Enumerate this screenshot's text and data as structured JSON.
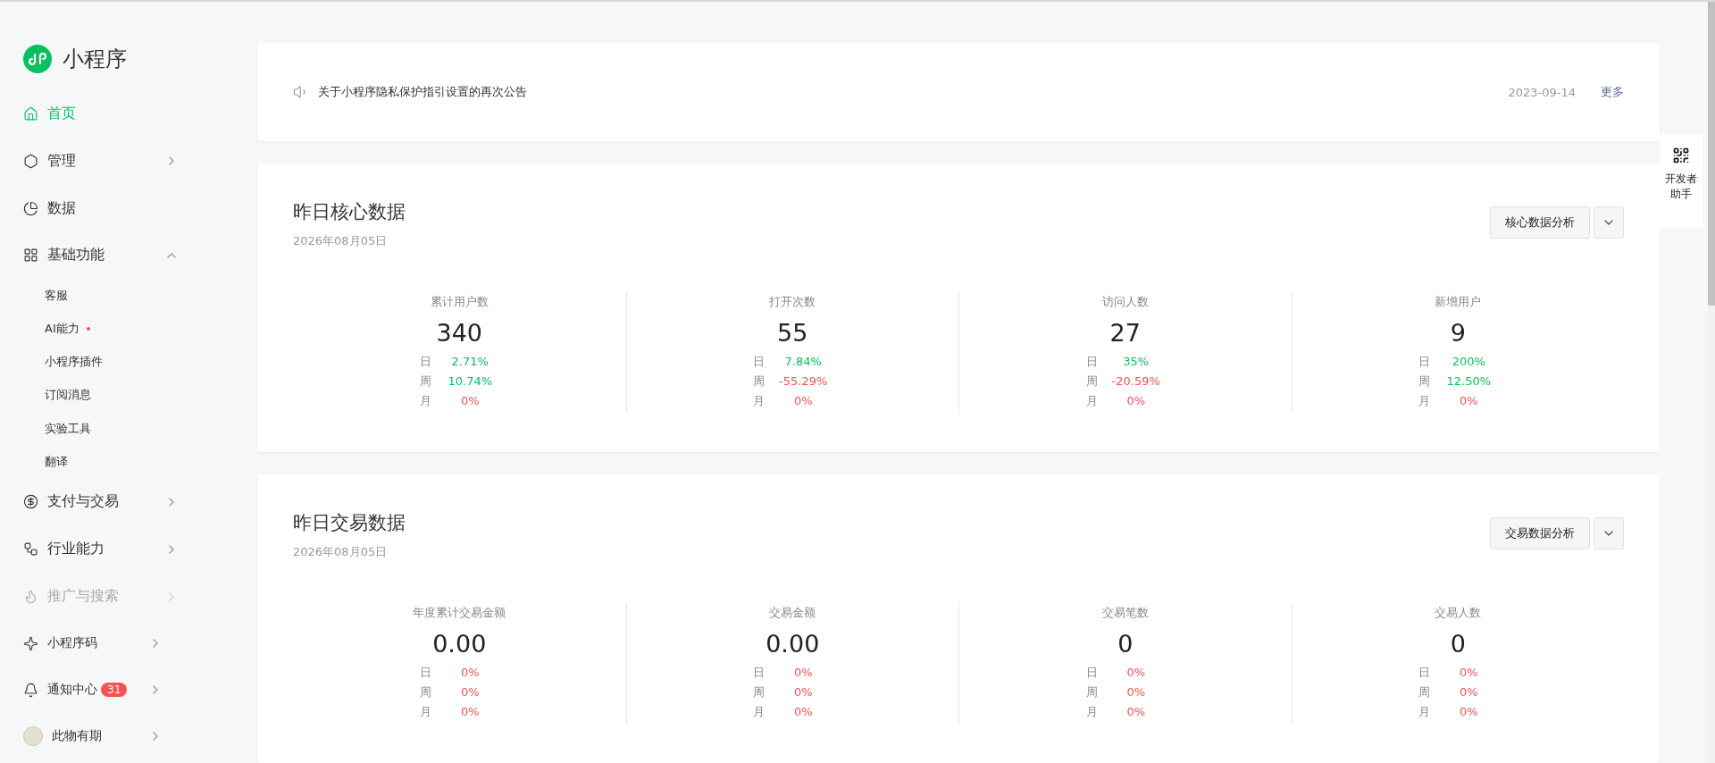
{
  "app": {
    "name": "小程序"
  },
  "sidebar": {
    "items": [
      {
        "label": "首页",
        "selected": true,
        "arrow": false
      },
      {
        "label": "管理",
        "selected": false,
        "arrow": true
      },
      {
        "label": "数据",
        "selected": false,
        "arrow": false
      },
      {
        "label": "基础功能",
        "selected": false,
        "arrow": true,
        "expanded": true,
        "children": [
          {
            "label": "客服",
            "selected": false,
            "dot": false
          },
          {
            "label": "AI能力",
            "selected": false,
            "dot": true
          },
          {
            "label": "小程序插件",
            "selected": false,
            "dot": false
          },
          {
            "label": "订阅消息",
            "selected": false,
            "dot": false
          },
          {
            "label": "实验工具",
            "selected": false,
            "dot": false
          },
          {
            "label": "翻译",
            "selected": false,
            "dot": false
          }
        ]
      },
      {
        "label": "支付与交易",
        "selected": false,
        "arrow": true
      },
      {
        "label": "行业能力",
        "selected": false,
        "arrow": true
      },
      {
        "label": "推广与搜索",
        "selected": false,
        "arrow": true,
        "faded": true
      }
    ],
    "footer": [
      {
        "label": "小程序码",
        "arrow": true
      },
      {
        "label": "通知中心",
        "arrow": true,
        "badge": "31"
      },
      {
        "label": "此物有期",
        "arrow": true
      }
    ]
  },
  "notice": {
    "text": "关于小程序隐私保护指引设置的再次公告",
    "date": "2023-09-14",
    "more": "更多"
  },
  "sections": [
    {
      "title": "昨日核心数据",
      "date": "2026年08月05日",
      "button": "核心数据分析",
      "metrics": [
        {
          "label": "累计用户数",
          "value": "340",
          "deltas": [
            {
              "period": "日",
              "value": "2.71%",
              "color": "#07c160"
            },
            {
              "period": "周",
              "value": "10.74%",
              "color": "#07c160"
            },
            {
              "period": "月",
              "value": "0%",
              "color": "#fa5151"
            }
          ]
        },
        {
          "label": "打开次数",
          "value": "55",
          "deltas": [
            {
              "period": "日",
              "value": "7.84%",
              "color": "#07c160"
            },
            {
              "period": "周",
              "value": "-55.29%",
              "color": "#fa5151"
            },
            {
              "period": "月",
              "value": "0%",
              "color": "#fa5151"
            }
          ]
        },
        {
          "label": "访问人数",
          "value": "27",
          "deltas": [
            {
              "period": "日",
              "value": "35%",
              "color": "#07c160"
            },
            {
              "period": "周",
              "value": "-20.59%",
              "color": "#fa5151"
            },
            {
              "period": "月",
              "value": "0%",
              "color": "#fa5151"
            }
          ]
        },
        {
          "label": "新增用户",
          "value": "9",
          "deltas": [
            {
              "period": "日",
              "value": "200%",
              "color": "#07c160"
            },
            {
              "period": "周",
              "value": "12.50%",
              "color": "#07c160"
            },
            {
              "period": "月",
              "value": "0%",
              "color": "#fa5151"
            }
          ]
        }
      ]
    },
    {
      "title": "昨日交易数据",
      "date": "2026年08月05日",
      "button": "交易数据分析",
      "metrics": [
        {
          "label": "年度累计交易金额",
          "value": "0.00",
          "deltas": [
            {
              "period": "日",
              "value": "0%",
              "color": "#fa5151"
            },
            {
              "period": "周",
              "value": "0%",
              "color": "#fa5151"
            },
            {
              "period": "月",
              "value": "0%",
              "color": "#fa5151"
            }
          ]
        },
        {
          "label": "交易金额",
          "value": "0.00",
          "deltas": [
            {
              "period": "日",
              "value": "0%",
              "color": "#fa5151"
            },
            {
              "period": "周",
              "value": "0%",
              "color": "#fa5151"
            },
            {
              "period": "月",
              "value": "0%",
              "color": "#fa5151"
            }
          ]
        },
        {
          "label": "交易笔数",
          "value": "0",
          "deltas": [
            {
              "period": "日",
              "value": "0%",
              "color": "#fa5151"
            },
            {
              "period": "周",
              "value": "0%",
              "color": "#fa5151"
            },
            {
              "period": "月",
              "value": "0%",
              "color": "#fa5151"
            }
          ]
        },
        {
          "label": "交易人数",
          "value": "0",
          "deltas": [
            {
              "period": "日",
              "value": "0%",
              "color": "#fa5151"
            },
            {
              "period": "周",
              "value": "0%",
              "color": "#fa5151"
            },
            {
              "period": "月",
              "value": "0%",
              "color": "#fa5151"
            }
          ]
        }
      ]
    }
  ],
  "helper": {
    "label": "开发者助手"
  }
}
